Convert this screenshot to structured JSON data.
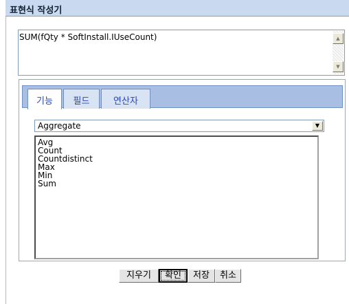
{
  "title": "표현식 작성기",
  "expression": "SUM(fQty * SoftInstall.IUseCount)",
  "tabs": [
    {
      "label": "기능",
      "active": true
    },
    {
      "label": "필드",
      "active": false
    },
    {
      "label": "연산자",
      "active": false
    }
  ],
  "category_select": {
    "value": "Aggregate"
  },
  "functions": [
    "Avg",
    "Count",
    "Countdistinct",
    "Max",
    "Min",
    "Sum"
  ],
  "buttons": {
    "clear": "지우기",
    "ok": "확인",
    "save": "저장",
    "cancel": "취소"
  }
}
